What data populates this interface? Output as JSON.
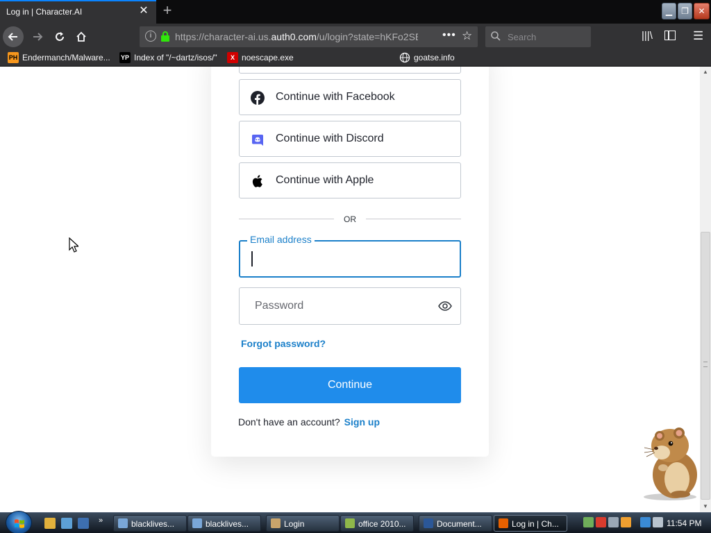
{
  "browser": {
    "tab_title": "Log in | Character.AI",
    "tab_close": "✕",
    "new_tab": "+",
    "url_prefix": "https://character-ai.us.",
    "url_domain": "auth0.com",
    "url_suffix": "/u/login?state=hKFo2SE",
    "search_placeholder": "Search",
    "bookmarks": [
      {
        "icon": "PH",
        "label": "Endermanch/Malware..."
      },
      {
        "icon": "YP",
        "label": "Index of \"/~dartz/isos/\""
      },
      {
        "icon": "X",
        "label": "noescape.exe"
      },
      {
        "icon": "globe",
        "label": "goatse.info"
      }
    ]
  },
  "login": {
    "social_buttons": [
      {
        "label": "",
        "icon": "blank"
      },
      {
        "label": "Continue with Facebook",
        "icon": "facebook-icon"
      },
      {
        "label": "Continue with Discord",
        "icon": "discord-icon"
      },
      {
        "label": "Continue with Apple",
        "icon": "apple-icon"
      }
    ],
    "divider_text": "OR",
    "email_label": "Email address",
    "email_value": "",
    "password_placeholder": "Password",
    "forgot_password": "Forgot password?",
    "continue_label": "Continue",
    "no_account_text": "Don't have an account?",
    "signup_label": "Sign up"
  },
  "taskbar": {
    "tasks": [
      {
        "label": "blacklives...",
        "icon_color": "#7aa7d8"
      },
      {
        "label": "blacklives...",
        "icon_color": "#7aa7d8"
      },
      {
        "label": "Login",
        "icon_color": "#c9a46b"
      },
      {
        "label": "office 2010...",
        "icon_color": "#8fb84a"
      },
      {
        "label": "Document...",
        "icon_color": "#2b5797"
      },
      {
        "label": "Log in | Ch...",
        "icon_color": "#e66000"
      }
    ],
    "clock": "11:54 PM"
  },
  "colors": {
    "accent": "#1a7fc9",
    "continue_button": "#1f8ceb",
    "browser_chrome": "#323234"
  }
}
